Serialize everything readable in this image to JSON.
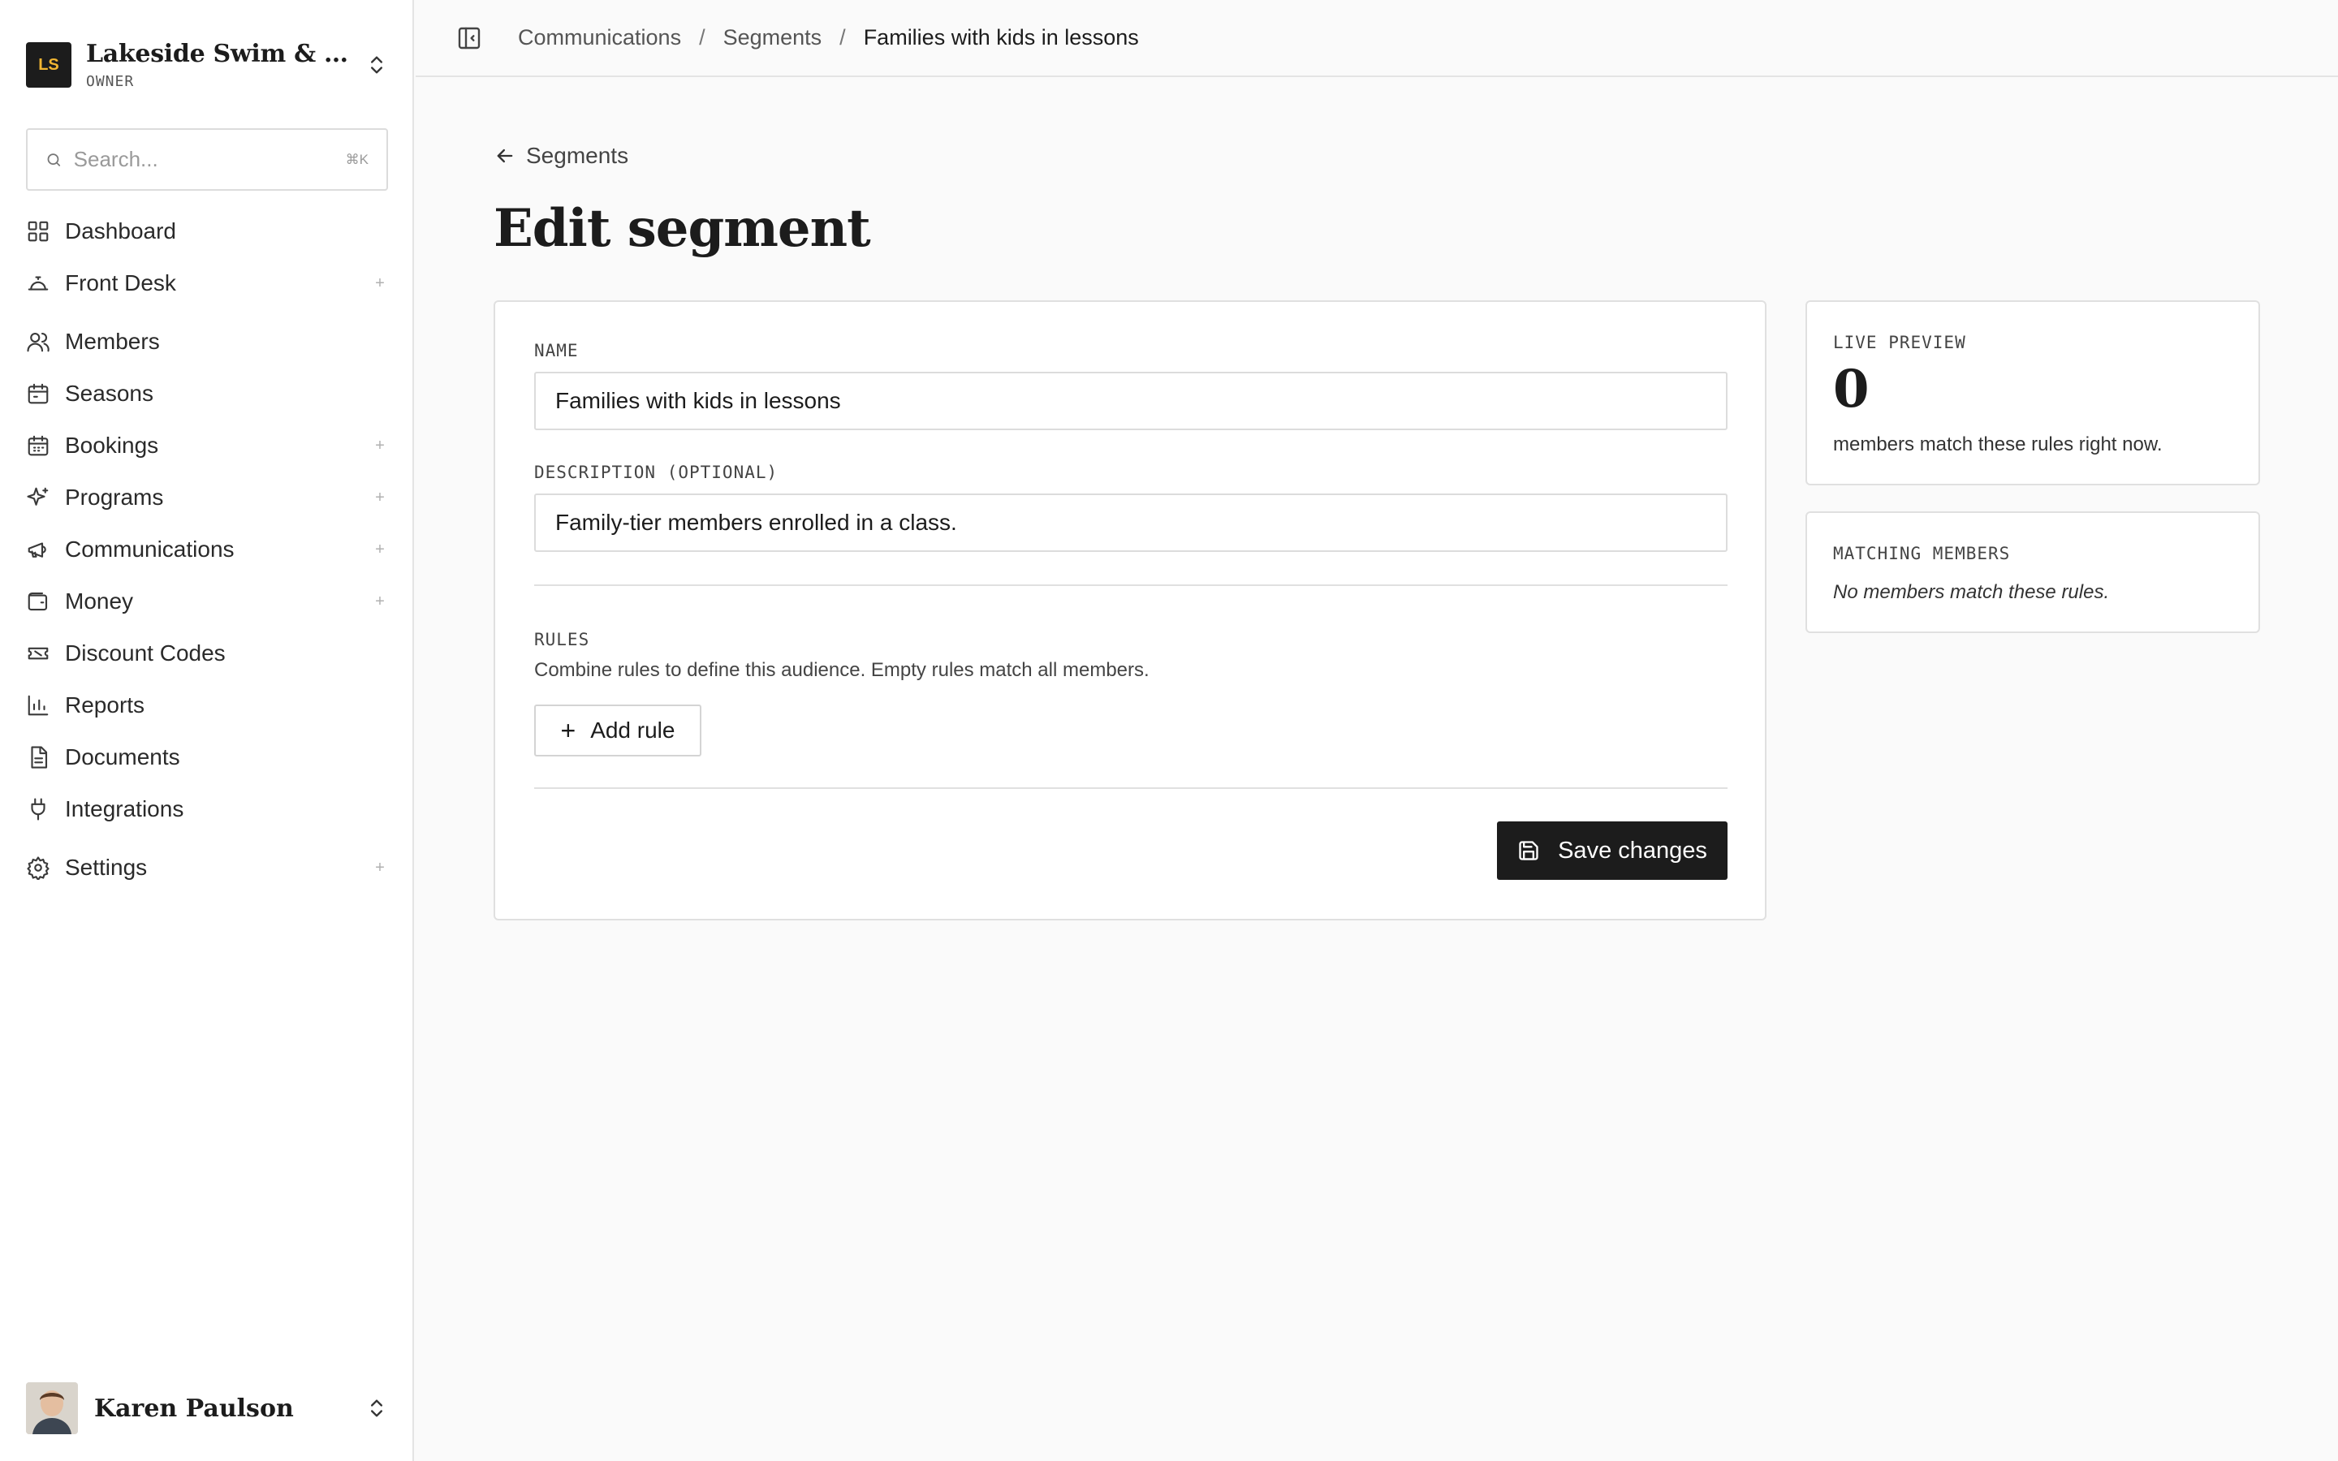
{
  "org": {
    "initials": "LS",
    "name": "Lakeside Swim & Tennis Club",
    "role": "OWNER"
  },
  "search": {
    "placeholder": "Search...",
    "shortcut": "⌘K"
  },
  "nav": [
    {
      "label": "Dashboard",
      "icon": "grid-icon",
      "expandable": false
    },
    {
      "label": "Front Desk",
      "icon": "bell-icon",
      "expandable": true
    },
    {
      "label": "Members",
      "icon": "users-icon",
      "expandable": false
    },
    {
      "label": "Seasons",
      "icon": "calendar-icon",
      "expandable": false
    },
    {
      "label": "Bookings",
      "icon": "calendar-grid-icon",
      "expandable": true
    },
    {
      "label": "Programs",
      "icon": "sparkles-icon",
      "expandable": true
    },
    {
      "label": "Communications",
      "icon": "megaphone-icon",
      "expandable": true
    },
    {
      "label": "Money",
      "icon": "wallet-icon",
      "expandable": true
    },
    {
      "label": "Discount Codes",
      "icon": "ticket-icon",
      "expandable": false
    },
    {
      "label": "Reports",
      "icon": "bar-chart-icon",
      "expandable": false
    },
    {
      "label": "Documents",
      "icon": "document-icon",
      "expandable": false
    },
    {
      "label": "Integrations",
      "icon": "plug-icon",
      "expandable": false
    },
    {
      "label": "Settings",
      "icon": "gear-icon",
      "expandable": true
    }
  ],
  "nav_plus": "+",
  "user": {
    "name": "Karen Paulson"
  },
  "breadcrumb": {
    "items": [
      "Communications",
      "Segments",
      "Families with kids in lessons"
    ],
    "separator": "/"
  },
  "back": {
    "label": "Segments"
  },
  "page": {
    "title": "Edit segment"
  },
  "form": {
    "name_label": "NAME",
    "name_value": "Families with kids in lessons",
    "description_label": "DESCRIPTION (OPTIONAL)",
    "description_value": "Family-tier members enrolled in a class.",
    "rules_label": "RULES",
    "rules_hint": "Combine rules to define this audience. Empty rules match all members.",
    "add_rule_label": "Add rule",
    "save_label": "Save changes"
  },
  "preview": {
    "label": "LIVE PREVIEW",
    "count": "0",
    "text": "members match these rules right now."
  },
  "matching": {
    "label": "MATCHING MEMBERS",
    "empty_text": "No members match these rules."
  }
}
